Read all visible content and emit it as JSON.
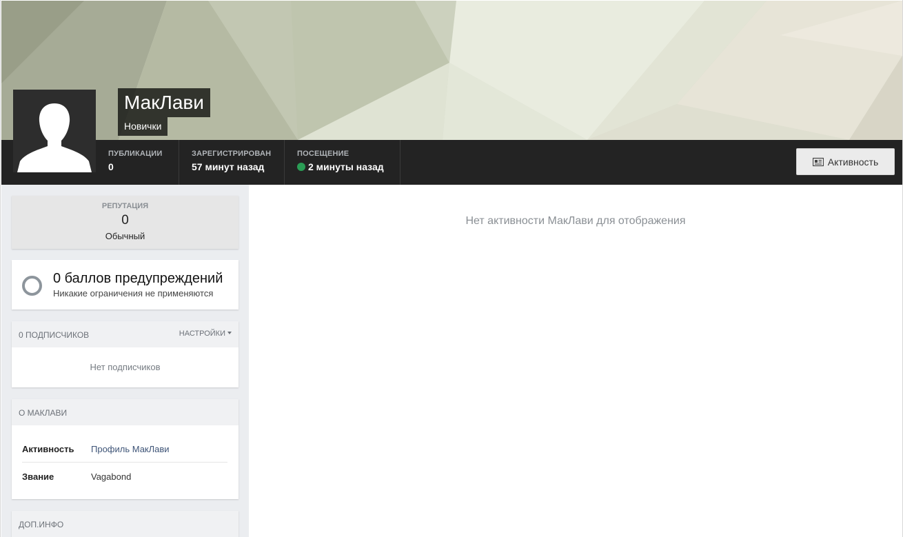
{
  "profile": {
    "name": "МакЛави",
    "group": "Новички"
  },
  "stats": {
    "posts_label": "ПУБЛИКАЦИИ",
    "posts_value": "0",
    "joined_label": "ЗАРЕГИСТРИРОВАН",
    "joined_value": "57 минут назад",
    "visit_label": "ПОСЕЩЕНИЕ",
    "visit_value": "2 минуты назад",
    "online_color": "#2a9d55"
  },
  "header": {
    "activity_button": "Активность",
    "activity_icon": "activity-newspaper-icon"
  },
  "reputation": {
    "label": "РЕПУТАЦИЯ",
    "value": "0",
    "level": "Обычный"
  },
  "warnings": {
    "title": "0 баллов предупреждений",
    "subtitle": "Никакие ограничения не применяются"
  },
  "followers": {
    "title": "0 ПОДПИСЧИКОВ",
    "settings_label": "НАСТРОЙКИ",
    "empty": "Нет подписчиков"
  },
  "about": {
    "title": "О МАКЛАВИ",
    "rows": [
      {
        "key": "Активность",
        "value": "Профиль МакЛави"
      },
      {
        "key": "Звание",
        "value": "Vagabond"
      }
    ]
  },
  "extra": {
    "title": "ДОП.ИНФО"
  },
  "main": {
    "empty_message": "Нет активности МакЛави для отображения"
  }
}
